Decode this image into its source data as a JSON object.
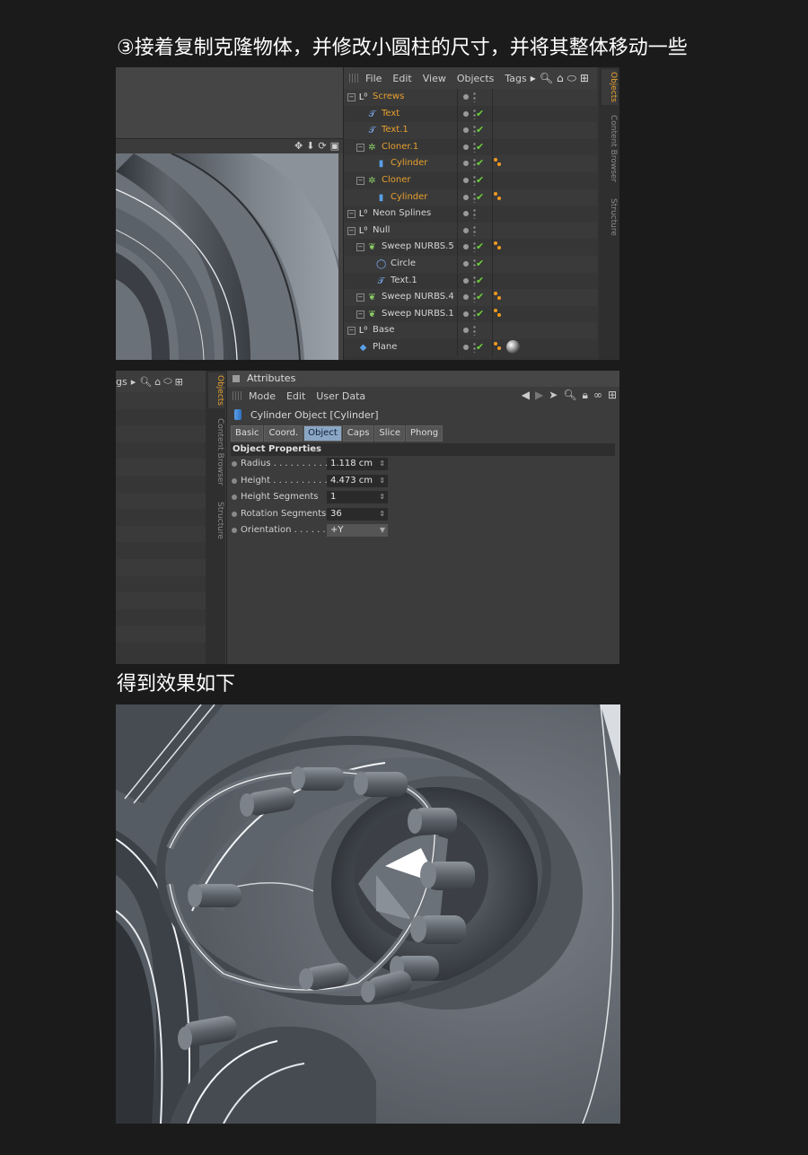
{
  "captions": {
    "step3": "③接着复制克隆物体，并修改小圆柱的尺寸，并将其整体移动一些",
    "result": "得到效果如下"
  },
  "viewport": {
    "controls": [
      "✥",
      "⬇",
      "⟳",
      "▣"
    ]
  },
  "object_manager": {
    "menu": [
      "File",
      "Edit",
      "View",
      "Objects",
      "Tags"
    ],
    "side_tabs": [
      "Objects",
      "Content Browser",
      "Structure"
    ],
    "rows": [
      {
        "name": "Screws",
        "selected": true,
        "icon": "null-icon"
      },
      {
        "name": "Text",
        "selected": true,
        "icon": "spline-text-icon"
      },
      {
        "name": "Text.1",
        "selected": true,
        "icon": "spline-text-icon"
      },
      {
        "name": "Cloner.1",
        "selected": true,
        "icon": "cloner-icon"
      },
      {
        "name": "Cylinder",
        "selected": true,
        "icon": "cylinder-icon"
      },
      {
        "name": "Cloner",
        "selected": true,
        "icon": "cloner-icon"
      },
      {
        "name": "Cylinder",
        "selected": true,
        "icon": "cylinder-icon"
      },
      {
        "name": "Neon Splines",
        "selected": false,
        "icon": "null-icon"
      },
      {
        "name": "Null",
        "selected": false,
        "icon": "null-icon"
      },
      {
        "name": "Sweep NURBS.5",
        "selected": false,
        "icon": "sweep-icon"
      },
      {
        "name": "Circle",
        "selected": false,
        "icon": "circle-spline-icon"
      },
      {
        "name": "Text.1",
        "selected": false,
        "icon": "spline-text-icon"
      },
      {
        "name": "Sweep NURBS.4",
        "selected": false,
        "icon": "sweep-icon"
      },
      {
        "name": "Sweep NURBS.1",
        "selected": false,
        "icon": "sweep-icon"
      },
      {
        "name": "Base",
        "selected": false,
        "icon": "null-icon"
      },
      {
        "name": "Plane",
        "selected": false,
        "icon": "plane-icon"
      }
    ]
  },
  "object_manager_2": {
    "menu_partial": "gs"
  },
  "attributes": {
    "title": "Attributes",
    "menu": [
      "Mode",
      "Edit",
      "User Data"
    ],
    "object_title": "Cylinder Object [Cylinder]",
    "tabs": [
      "Basic",
      "Coord.",
      "Object",
      "Caps",
      "Slice",
      "Phong"
    ],
    "active_tab": "Object",
    "section": "Object Properties",
    "properties": [
      {
        "label": "Radius . . . . . . . . . .",
        "value": "1.118 cm"
      },
      {
        "label": "Height . . . . . . . . . .",
        "value": "4.473 cm"
      },
      {
        "label": "Height Segments",
        "value": "1"
      },
      {
        "label": "Rotation Segments",
        "value": "36"
      },
      {
        "label": "Orientation . . . . . .",
        "value": "+Y"
      }
    ]
  }
}
